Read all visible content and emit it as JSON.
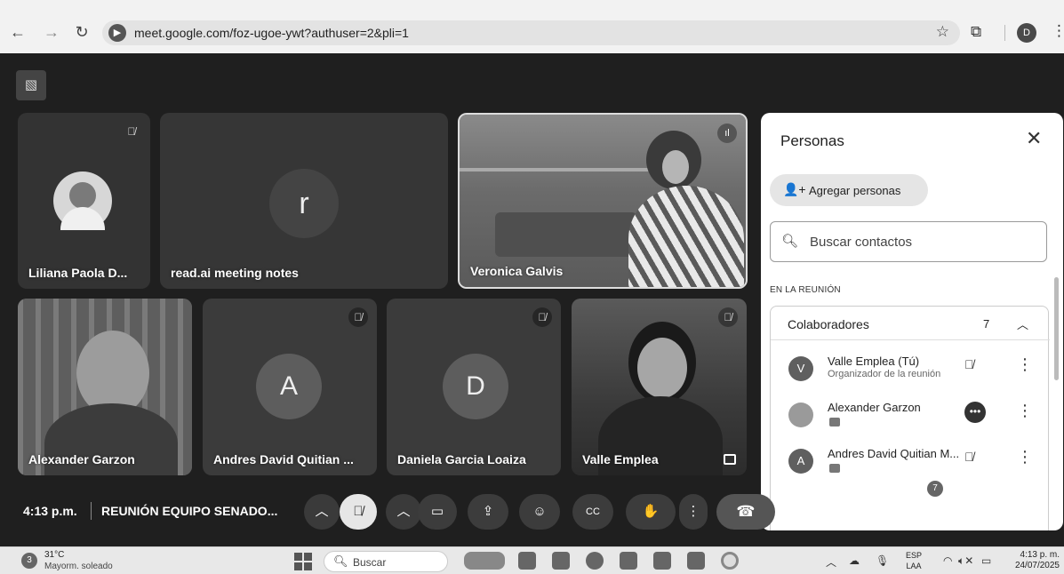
{
  "browser": {
    "url": "meet.google.com/foz-ugoe-ywt?authuser=2&pli=1",
    "profile_initial": "D"
  },
  "tiles": [
    {
      "name": "Liliana Paola D..."
    },
    {
      "name": "read.ai meeting notes",
      "initial": "r"
    },
    {
      "name": "Veronica Galvis"
    },
    {
      "name": "Alexander Garzon"
    },
    {
      "name": "Andres David Quitian ...",
      "initial": "A"
    },
    {
      "name": "Daniela Garcia Loaiza",
      "initial": "D"
    },
    {
      "name": "Valle Emplea"
    }
  ],
  "panel": {
    "title": "Personas",
    "add_label": "Agregar personas",
    "search_placeholder": "Buscar contactos",
    "section": "EN LA REUNIÓN",
    "group_title": "Colaboradores",
    "group_count": "7",
    "participants": [
      {
        "initial": "V",
        "name": "Valle Emplea (Tú)",
        "sub": "Organizador de la reunión"
      },
      {
        "initial": "",
        "name": "Alexander Garzon",
        "sub": ""
      },
      {
        "initial": "A",
        "name": "Andres David Quitian M...",
        "sub": ""
      }
    ]
  },
  "meeting": {
    "time": "4:13 p.m.",
    "name": "REUNIÓN EQUIPO SENADO...",
    "people_count": "7"
  },
  "taskbar": {
    "temp": "31°C",
    "condition": "Mayorm. soleado",
    "weather_badge": "3",
    "search": "Buscar",
    "lang1": "ESP",
    "lang2": "LAA",
    "time": "4:13 p. m.",
    "date": "24/07/2025"
  },
  "colors": {
    "meet_bg": "#1f1f1f",
    "tile_bg": "#3b3b3b",
    "panel_bg": "#ffffff"
  }
}
